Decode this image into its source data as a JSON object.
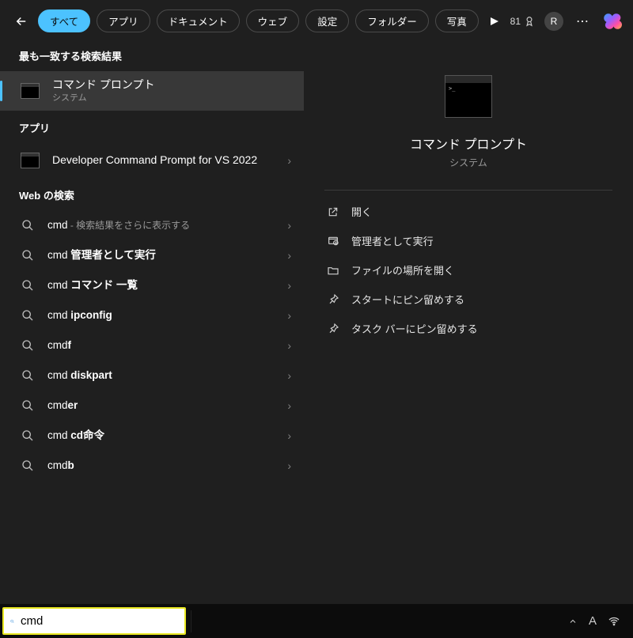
{
  "header": {
    "tabs": [
      {
        "label": "すべて",
        "active": true
      },
      {
        "label": "アプリ"
      },
      {
        "label": "ドキュメント"
      },
      {
        "label": "ウェブ"
      },
      {
        "label": "設定"
      },
      {
        "label": "フォルダー"
      },
      {
        "label": "写真"
      }
    ],
    "points": "81",
    "user_initial": "R"
  },
  "sections": {
    "best_match": "最も一致する検索結果",
    "apps": "アプリ",
    "web": "Web の検索"
  },
  "results": {
    "top": {
      "title": "コマンド プロンプト",
      "subtitle": "システム"
    },
    "apps": [
      {
        "title": "Developer Command Prompt for VS 2022"
      }
    ],
    "web": [
      {
        "prefix": "cmd",
        "suffix": " - 検索結果をさらに表示する"
      },
      {
        "prefix": "cmd ",
        "bold": "管理者として実行"
      },
      {
        "prefix": "cmd ",
        "bold": "コマンド 一覧"
      },
      {
        "prefix": "cmd ",
        "bold": "ipconfig"
      },
      {
        "prefix": "cmd",
        "bold": "f"
      },
      {
        "prefix": "cmd ",
        "bold": "diskpart"
      },
      {
        "prefix": "cmd",
        "bold": "er"
      },
      {
        "prefix": "cmd ",
        "bold": "cd命令"
      },
      {
        "prefix": "cmd",
        "bold": "b"
      }
    ]
  },
  "detail": {
    "title": "コマンド プロンプト",
    "subtitle": "システム",
    "actions": [
      {
        "icon": "open",
        "label": "開く"
      },
      {
        "icon": "admin",
        "label": "管理者として実行"
      },
      {
        "icon": "folder",
        "label": "ファイルの場所を開く"
      },
      {
        "icon": "pin",
        "label": "スタートにピン留めする"
      },
      {
        "icon": "pin",
        "label": "タスク バーにピン留めする"
      }
    ]
  },
  "taskbar": {
    "search_value": "cmd",
    "ime": "A"
  }
}
